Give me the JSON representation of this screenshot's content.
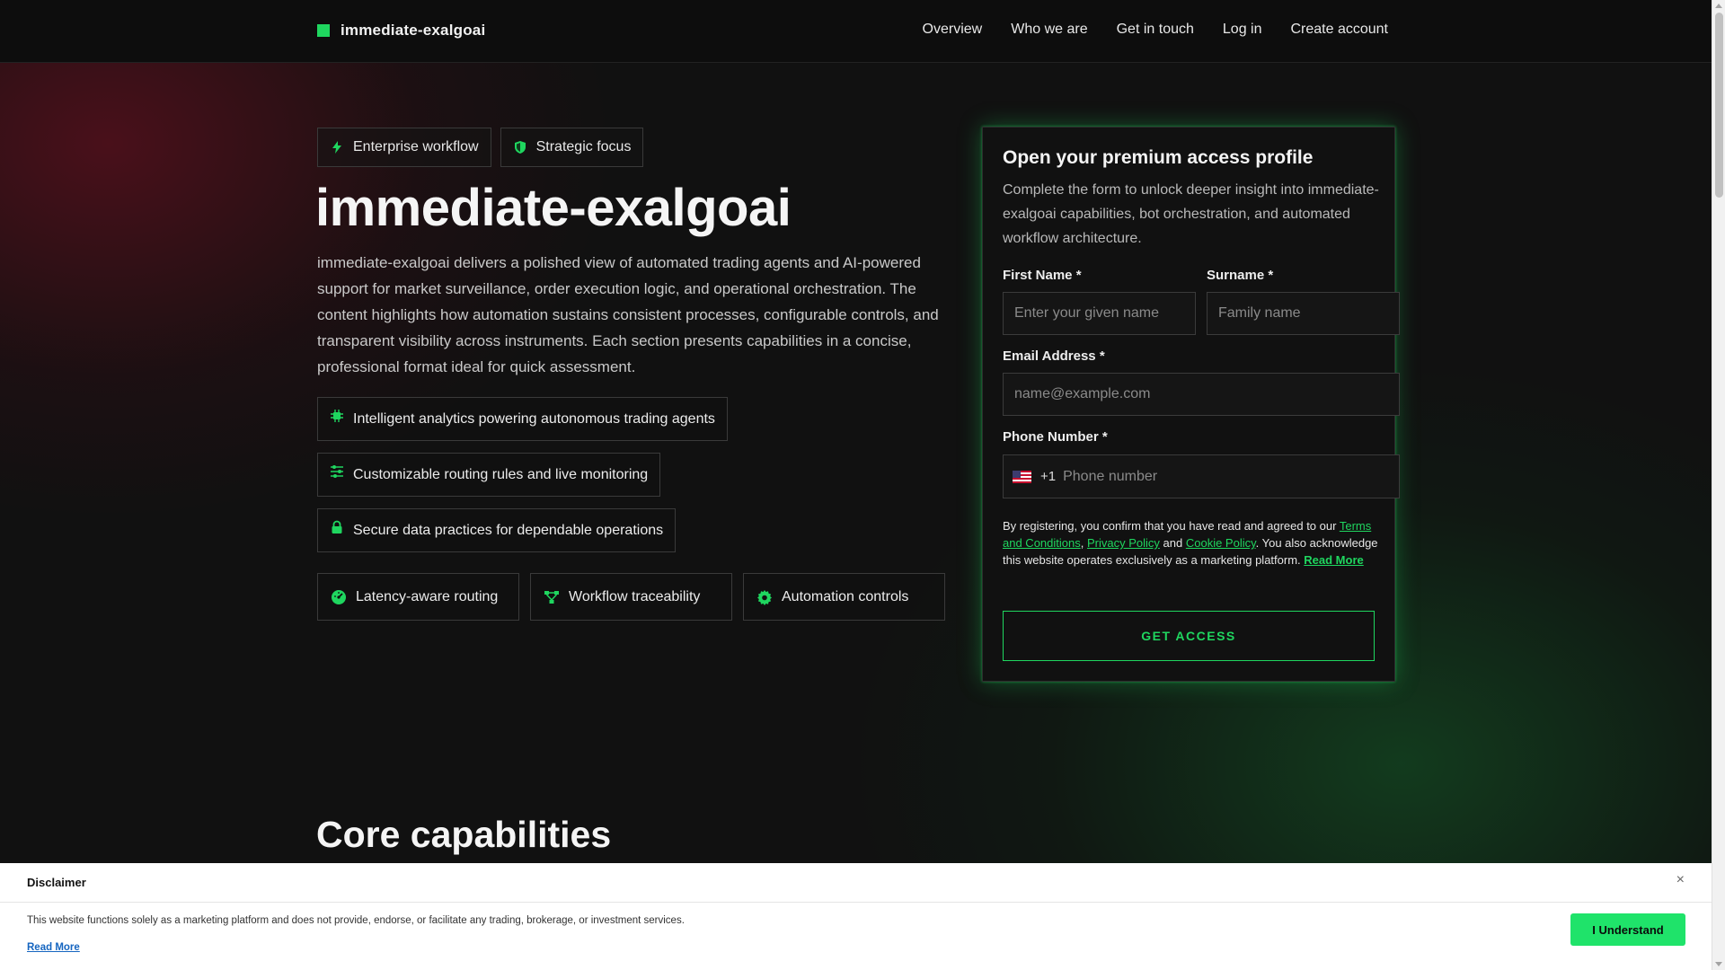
{
  "header": {
    "brand": "immediate-exalgoai",
    "nav": [
      "Overview",
      "Who we are",
      "Get in touch",
      "Log in",
      "Create account"
    ]
  },
  "hero": {
    "tags": [
      {
        "label": "Enterprise workflow",
        "icon": "bolt-icon"
      },
      {
        "label": "Strategic focus",
        "icon": "shield-icon"
      }
    ],
    "title": "immediate-exalgoai",
    "description": "immediate-exalgoai delivers a polished view of automated trading agents and AI-powered support for market surveillance, order execution logic, and operational orchestration. The content highlights how automation sustains consistent processes, configurable controls, and transparent visibility across instruments. Each section presents capabilities in a concise, professional format ideal for quick assessment.",
    "features": [
      {
        "label": "Intelligent analytics powering autonomous trading agents",
        "icon": "chip-icon"
      },
      {
        "label": "Customizable routing rules and live monitoring",
        "icon": "sliders-icon"
      },
      {
        "label": "Secure data practices for dependable operations",
        "icon": "lock-icon"
      }
    ],
    "chips": [
      {
        "label": "Latency-aware routing",
        "icon": "gauge-icon"
      },
      {
        "label": "Workflow traceability",
        "icon": "network-icon"
      },
      {
        "label": "Automation controls",
        "icon": "gear-icon"
      }
    ]
  },
  "form": {
    "title": "Open your premium access profile",
    "description": "Complete the form to unlock deeper insight into immediate-exalgoai capabilities, bot orchestration, and automated workflow architecture.",
    "first_name_label": "First Name *",
    "first_name_placeholder": "Enter your given name",
    "surname_label": "Surname *",
    "surname_placeholder": "Family name",
    "email_label": "Email Address *",
    "email_placeholder": "name@example.com",
    "phone_label": "Phone Number *",
    "phone_dial_code": "+1",
    "phone_placeholder": "Phone number",
    "legal_intro": "By registering, you confirm that you have read and agreed to our",
    "terms_link": "Terms and Conditions",
    "privacy_link": "Privacy Policy",
    "and_text": "and",
    "cookie_link": "Cookie Policy",
    "legal_tail": ". You also acknowledge this website operates exclusively as a marketing platform.",
    "read_more": "Read More",
    "submit_label": "GET ACCESS"
  },
  "section": {
    "title": "Core capabilities"
  },
  "disclaimer": {
    "title": "Disclaimer",
    "text": "This website functions solely as a marketing platform and does not provide, endorse, or facilitate any trading, brokerage, or investment services.",
    "read_more": "Read More",
    "button": "I Understand",
    "close": "×"
  },
  "colors": {
    "accent": "#1fd65f",
    "background": "#111111",
    "button_green": "#1fe36a"
  }
}
